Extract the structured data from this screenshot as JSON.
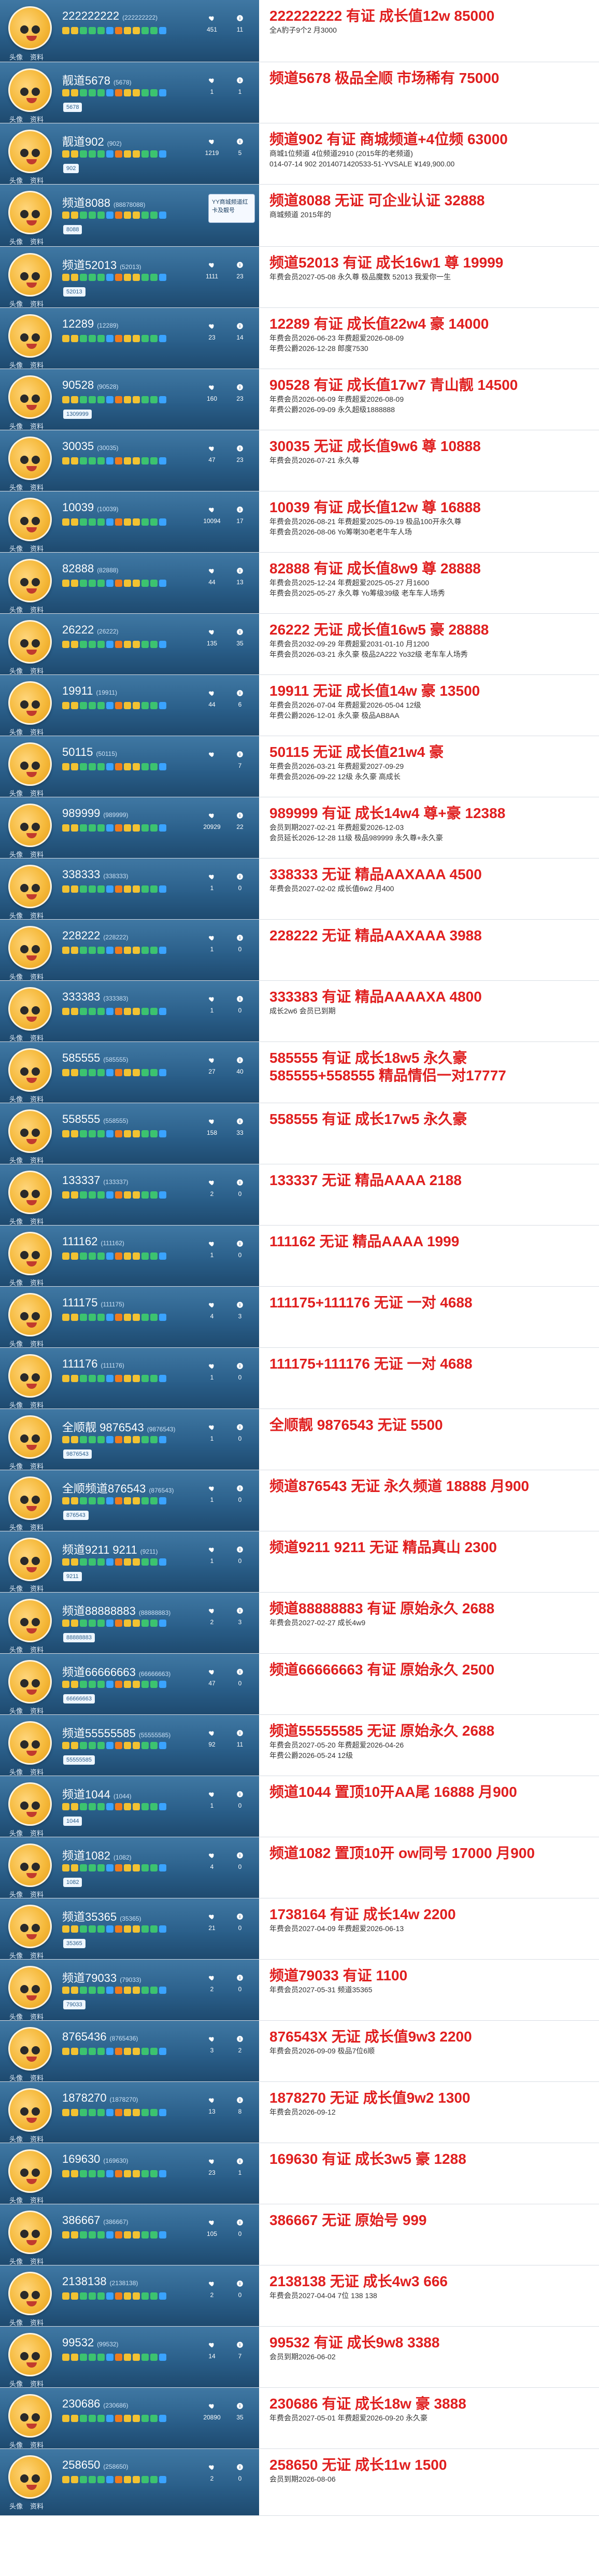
{
  "icons": {
    "heart": "heart-icon",
    "info": "info-icon",
    "avatar": "avatar-icon"
  },
  "avatar_caption": {
    "left": "头像",
    "right": "资料"
  },
  "rows": [
    {
      "name": "222222222",
      "name_tail": "(222222222)",
      "mini_tag": "",
      "likes": "451",
      "info": "11",
      "headline": "222222222  有证   成长值12w   85000",
      "subs": [
        "全A豹子9个2  月3000"
      ]
    },
    {
      "name": "靓道5678",
      "name_tail": "(5678)",
      "mini_tag": "5678",
      "likes": "1",
      "info": "1",
      "headline": "频道5678   极品全顺  市场稀有   75000",
      "subs": []
    },
    {
      "name": "靓道902",
      "name_tail": "(902)",
      "mini_tag": "902",
      "likes": "1219",
      "info": "5",
      "headline": "频道902  有证  商城频道+4位频  63000",
      "subs": [
        "商城1位频道  4位频道2910   (2015年的老频道)"
      ],
      "extra_line": "014-07-14     902             2014071420533-51-YVSALE     ¥149,900.00"
    },
    {
      "name": "频道8088",
      "name_tail": "(88878088)",
      "mini_tag": "8088",
      "likes": "1",
      "info": "0",
      "headline": "频道8088  无证   可企业认证      32888",
      "subs": [
        "商城频道 2015年的"
      ],
      "popup": "YY商城频道红卡及靓号"
    },
    {
      "name": "频道52013",
      "name_tail": "(52013)",
      "mini_tag": "52013",
      "likes": "1111",
      "info": "23",
      "headline": "频道52013 有证   成长16w1  尊   19999",
      "subs": [
        "年费会员2027-05-08     永久尊   极品魔数 52013 我爱你一生"
      ]
    },
    {
      "name": "12289",
      "name_tail": "(12289)",
      "mini_tag": "",
      "likes": "23",
      "info": "14",
      "headline": "12289  有证  成长值22w4        豪     14000",
      "subs": [
        "年费会员2026-06-23    年费超爱2026-08-09",
        "年费公爵2026-12-28    郎度7530"
      ]
    },
    {
      "name": "90528",
      "name_tail": "(90528)",
      "mini_tag": "1309999",
      "likes": "160",
      "info": "23",
      "headline": "90528  有证   成长值17w7  青山靓   14500",
      "subs": [
        "年费会员2026-06-09    年费超爱2026-08-09",
        "年费公爵2026-09-09    永久超级1888888"
      ]
    },
    {
      "name": "30035",
      "name_tail": "(30035)",
      "mini_tag": "",
      "likes": "47",
      "info": "23",
      "headline": "30035  无证   成长值9w6        尊      10888",
      "subs": [
        "年费会员2026-07-21      永久尊"
      ]
    },
    {
      "name": "10039",
      "name_tail": "(10039)",
      "mini_tag": "",
      "likes": "10094",
      "info": "17",
      "headline": "10039  有证   成长值12w        尊      16888",
      "subs": [
        "年费会员2026-08-21   年费超爱2025-09-19   极品100开永久尊",
        "年费会员2026-08-06   Yo筹喇30老老牛车人场"
      ]
    },
    {
      "name": "82888",
      "name_tail": "(82888)",
      "mini_tag": "",
      "likes": "44",
      "info": "13",
      "headline": "82888  有证   成长值8w9        尊      28888",
      "subs": [
        "年费会员2025-12-24   年费超爱2025-05-27   月1600",
        "年费会员2025-05-27   永久尊  Yo筹级39级  老车车人场秀"
      ]
    },
    {
      "name": "26222",
      "name_tail": "(26222)",
      "mini_tag": "",
      "likes": "135",
      "info": "35",
      "headline": "26222  无证   成长值16w5       豪     28888",
      "subs": [
        "年费会员2032-09-29   年费超爱2031-01-10   月1200",
        "年费会员2026-03-21   永久豪 极品2A222   Yo32级 老车车人场秀"
      ]
    },
    {
      "name": "19911",
      "name_tail": "(19911)",
      "mini_tag": "",
      "likes": "44",
      "info": "6",
      "headline": "19911  无证   成长值14w        豪     13500",
      "subs": [
        "年费会员2026-07-04   年费超爱2026-05-04  12级",
        "年费公爵2026-12-01   永久豪 极品AB8AA"
      ]
    },
    {
      "name": "50115",
      "name_tail": "(50115)",
      "mini_tag": "",
      "likes": "",
      "info": "7",
      "headline": "50115  无证   成长值21w4       豪",
      "subs": [
        "年费会员2026-03-21   年费超爱2027-09-29",
        "年费会员2026-09-22   12级  永久豪 高成长"
      ]
    },
    {
      "name": "989999",
      "name_tail": "(989999)",
      "mini_tag": "",
      "likes": "20929",
      "info": "22",
      "headline": "989999  有证   成长14w4 尊+豪   12388",
      "subs": [
        "会员到期2027-02-21   年费超爱2026-12-03",
        "会员延长2026-12-28   11级  极品989999 永久尊+永久豪"
      ]
    },
    {
      "name": "338333",
      "name_tail": "(338333)",
      "mini_tag": "",
      "likes": "1",
      "info": "0",
      "headline": "338333  无证   精品AAXAAA    4500",
      "subs": [
        "年费会员2027-02-02    成长值6w2  月400"
      ]
    },
    {
      "name": "228222",
      "name_tail": "(228222)",
      "mini_tag": "",
      "likes": "1",
      "info": "0",
      "headline": "228222  无证   精品AAXAAA    3988",
      "subs": []
    },
    {
      "name": "333383",
      "name_tail": "(333383)",
      "mini_tag": "",
      "likes": "1",
      "info": "0",
      "headline": "333383  有证   精品AAAAXA  4800",
      "subs": [
        "成长2w6  会员已到期"
      ]
    },
    {
      "name": "585555",
      "name_tail": "(585555)",
      "mini_tag": "",
      "likes": "27",
      "info": "40",
      "headline": "585555  有证  成长18w5     永久豪",
      "subs": [],
      "headline2": "585555+558555 精品情侣一对17777"
    },
    {
      "name": "558555",
      "name_tail": "(558555)",
      "mini_tag": "",
      "likes": "158",
      "info": "33",
      "headline": "558555  有证  成长17w5     永久豪",
      "subs": []
    },
    {
      "name": "133337",
      "name_tail": "(133337)",
      "mini_tag": "",
      "likes": "2",
      "info": "0",
      "headline": "133337   无证   精品AAAA     2188",
      "subs": []
    },
    {
      "name": "111162",
      "name_tail": "(111162)",
      "mini_tag": "",
      "likes": "1",
      "info": "0",
      "headline": "111162   无证   精品AAAA     1999",
      "subs": []
    },
    {
      "name": "111175",
      "name_tail": "(111175)",
      "mini_tag": "",
      "likes": "4",
      "info": "3",
      "headline": "111175+111176  无证  一对   4688",
      "subs": []
    },
    {
      "name": "111176",
      "name_tail": "(111176)",
      "mini_tag": "",
      "likes": "1",
      "info": "0",
      "headline": "111175+111176  无证  一对   4688",
      "subs": []
    },
    {
      "name": "全顺靓 9876543",
      "name_tail": "(9876543)",
      "mini_tag": "9876543",
      "likes": "1",
      "info": "0",
      "headline": "全顺靓     9876543   无证         5500",
      "subs": []
    },
    {
      "name": "全顺频道876543",
      "name_tail": "(876543)",
      "mini_tag": "876543",
      "likes": "1",
      "info": "0",
      "headline": "频道876543  无证  永久频道    18888   月900",
      "subs": []
    },
    {
      "name": "频道9211 9211",
      "name_tail": "(9211)",
      "mini_tag": "9211",
      "likes": "1",
      "info": "0",
      "headline": "频道9211 9211  无证   精品真山   2300",
      "subs": []
    },
    {
      "name": "频道88888883",
      "name_tail": "(88888883)",
      "mini_tag": "88888883",
      "likes": "2",
      "info": "3",
      "headline": "频道88888883   有证   原始永久   2688",
      "subs": [
        "年费会员2027-02-27     成长4w9"
      ]
    },
    {
      "name": "频道66666663",
      "name_tail": "(66666663)",
      "mini_tag": "66666663",
      "likes": "47",
      "info": "0",
      "headline": "频道66666663   有证   原始永久   2500",
      "subs": []
    },
    {
      "name": "频道55555585",
      "name_tail": "(55555585)",
      "mini_tag": "55555585",
      "likes": "92",
      "info": "11",
      "headline": "频道55555585    无证   原始永久   2688",
      "subs": [
        "年费会员2027-05-20   年费超爱2026-04-26",
        "年费公爵2026-05-24   12级"
      ]
    },
    {
      "name": "频道1044",
      "name_tail": "(1044)",
      "mini_tag": "1044",
      "likes": "1",
      "info": "0",
      "headline": "频道1044   置顶10开AA尾   16888   月900",
      "subs": []
    },
    {
      "name": "频道1082",
      "name_tail": "(1082)",
      "mini_tag": "1082",
      "likes": "4",
      "info": "0",
      "headline": "频道1082   置顶10开  ow同号     17000   月900",
      "subs": []
    },
    {
      "name": "频道35365",
      "name_tail": "(35365)",
      "mini_tag": "35365",
      "likes": "21",
      "info": "0",
      "headline": "1738164  有证  成长14w   2200",
      "subs": [
        "年费会员2027-04-09    年费超爱2026-06-13"
      ]
    },
    {
      "name": "频道79033",
      "name_tail": "(79033)",
      "mini_tag": "79033",
      "likes": "2",
      "info": "0",
      "headline": "频道79033  有证   1100",
      "subs": [
        "年费会员2027-05-31   频道35365"
      ]
    },
    {
      "name": "8765436",
      "name_tail": "(8765436)",
      "mini_tag": "",
      "likes": "3",
      "info": "2",
      "headline": "876543X  无证  成长值9w3  2200",
      "subs": [
        "年费会员2026-09-09   极品7位6顺"
      ]
    },
    {
      "name": "1878270",
      "name_tail": "(1878270)",
      "mini_tag": "",
      "likes": "13",
      "info": "8",
      "headline": "1878270  无证  成长值9w2  1300",
      "subs": [
        "年费会员2026-09-12"
      ]
    },
    {
      "name": "169630",
      "name_tail": "(169630)",
      "mini_tag": "",
      "likes": "23",
      "info": "1",
      "headline": "169630    有证  成长3w5  豪  1288",
      "subs": []
    },
    {
      "name": "386667",
      "name_tail": "(386667)",
      "mini_tag": "",
      "likes": "105",
      "info": "0",
      "headline": "386667   无证   原始号        999",
      "subs": []
    },
    {
      "name": "2138138",
      "name_tail": "(2138138)",
      "mini_tag": "",
      "likes": "2",
      "info": "0",
      "headline": "2138138   无证   成长4w3     666",
      "subs": [
        "年费会员2027-04-04   7位 138 138"
      ]
    },
    {
      "name": "99532",
      "name_tail": "(99532)",
      "mini_tag": "",
      "likes": "14",
      "info": "7",
      "headline": "99532    有证   成长9w8   3388",
      "subs": [
        "会员到期2026-06-02"
      ]
    },
    {
      "name": "230686",
      "name_tail": "(230686)",
      "mini_tag": "",
      "likes": "20890",
      "info": "35",
      "headline": "230686    有证   成长18w  豪   3888",
      "subs": [
        "年费会员2027-05-01   年费超爱2026-09-20   永久豪"
      ]
    },
    {
      "name": "258650",
      "name_tail": "(258650)",
      "mini_tag": "",
      "likes": "2",
      "info": "0",
      "headline": "258650    无证   成长11w     1500",
      "subs": [
        "会员到期2026-08-06"
      ]
    }
  ]
}
